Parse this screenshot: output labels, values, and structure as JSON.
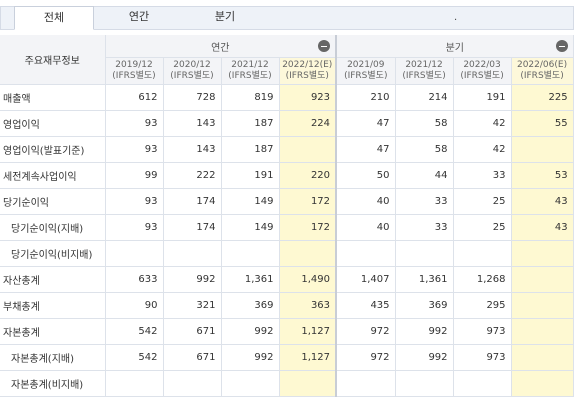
{
  "tabs": [
    {
      "label": "전체",
      "active": true
    },
    {
      "label": "연간",
      "active": false
    },
    {
      "label": "분기",
      "active": false
    }
  ],
  "tab_dot": ".",
  "table": {
    "corner_label": "주요재무정보",
    "group_annual": "연간",
    "group_quarter": "분기",
    "annual_columns": [
      {
        "period": "2019/12",
        "basis": "(IFRS별도)"
      },
      {
        "period": "2020/12",
        "basis": "(IFRS별도)"
      },
      {
        "period": "2021/12",
        "basis": "(IFRS별도)"
      },
      {
        "period": "2022/12(E)",
        "basis": "(IFRS별도)"
      }
    ],
    "quarter_columns": [
      {
        "period": "2021/09",
        "basis": "(IFRS별도)"
      },
      {
        "period": "2021/12",
        "basis": "(IFRS별도)"
      },
      {
        "period": "2022/03",
        "basis": "(IFRS별도)"
      },
      {
        "period": "2022/06(E)",
        "basis": "(IFRS별도)"
      }
    ],
    "rows": [
      {
        "label": "매출액",
        "indent": false,
        "values": [
          "612",
          "728",
          "819",
          "923",
          "210",
          "214",
          "191",
          "225"
        ]
      },
      {
        "label": "영업이익",
        "indent": false,
        "values": [
          "93",
          "143",
          "187",
          "224",
          "47",
          "58",
          "42",
          "55"
        ]
      },
      {
        "label": "영업이익(발표기준)",
        "indent": false,
        "values": [
          "93",
          "143",
          "187",
          "",
          "47",
          "58",
          "42",
          ""
        ]
      },
      {
        "label": "세전계속사업이익",
        "indent": false,
        "values": [
          "99",
          "222",
          "191",
          "220",
          "50",
          "44",
          "33",
          "53"
        ]
      },
      {
        "label": "당기순이익",
        "indent": false,
        "values": [
          "93",
          "174",
          "149",
          "172",
          "40",
          "33",
          "25",
          "43"
        ]
      },
      {
        "label": "당기순이익(지배)",
        "indent": true,
        "values": [
          "93",
          "174",
          "149",
          "172",
          "40",
          "33",
          "25",
          "43"
        ]
      },
      {
        "label": "당기순이익(비지배)",
        "indent": true,
        "values": [
          "",
          "",
          "",
          "",
          "",
          "",
          "",
          ""
        ]
      },
      {
        "label": "자산총계",
        "indent": false,
        "values": [
          "633",
          "992",
          "1,361",
          "1,490",
          "1,407",
          "1,361",
          "1,268",
          ""
        ]
      },
      {
        "label": "부채총계",
        "indent": false,
        "values": [
          "90",
          "321",
          "369",
          "363",
          "435",
          "369",
          "295",
          ""
        ]
      },
      {
        "label": "자본총계",
        "indent": false,
        "values": [
          "542",
          "671",
          "992",
          "1,127",
          "972",
          "992",
          "973",
          ""
        ]
      },
      {
        "label": "자본총계(지배)",
        "indent": true,
        "values": [
          "542",
          "671",
          "992",
          "1,127",
          "972",
          "992",
          "973",
          ""
        ]
      },
      {
        "label": "자본총계(비지배)",
        "indent": true,
        "values": [
          "",
          "",
          "",
          "",
          "",
          "",
          "",
          ""
        ]
      }
    ]
  }
}
